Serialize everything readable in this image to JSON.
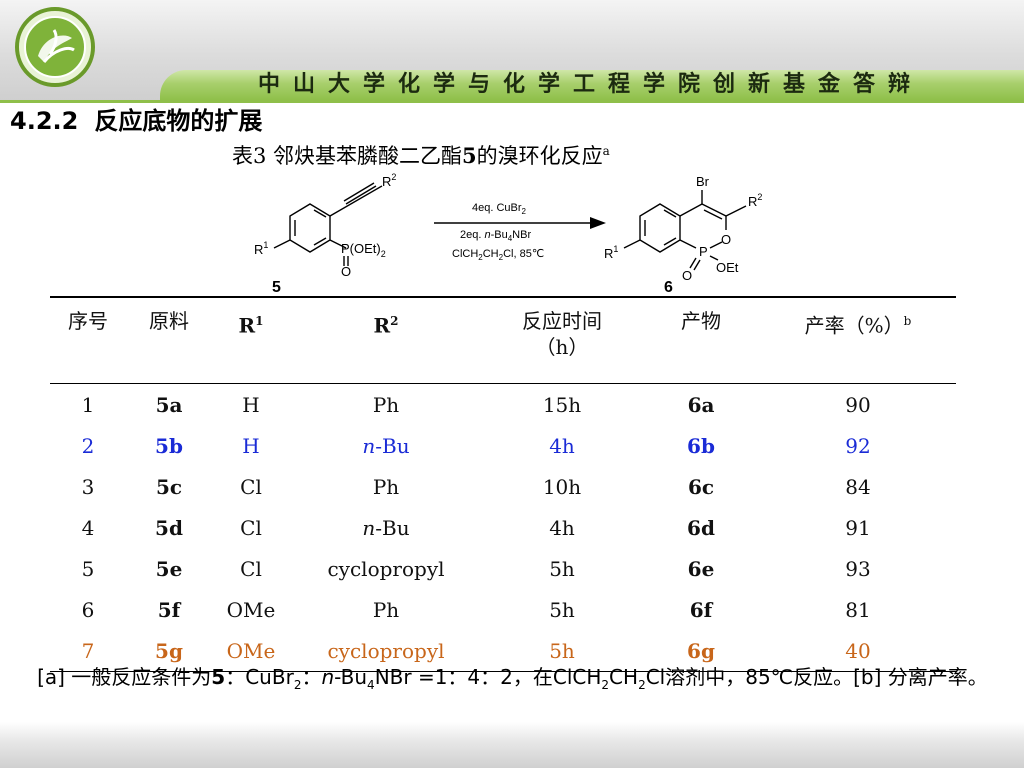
{
  "header": {
    "banner_text": "中山大学化学与化学工程学院创新基金答辩",
    "colors": {
      "strip": "#9fc95c",
      "line": "#8fbf4a",
      "logo": "#6a9a2a"
    }
  },
  "section": {
    "number": "4.2.2",
    "title": "反应底物的扩展"
  },
  "caption": {
    "prefix": "表3 邻炔基苯膦酸二乙酯",
    "bold_num": "5",
    "suffix": "的溴环化反应",
    "sup": "a"
  },
  "scheme": {
    "reactant_label": "5",
    "product_label": "6",
    "reactant": {
      "r1": "R",
      "r1_sup": "1",
      "r2": "R",
      "r2_sup": "2",
      "phos": "P(OEt)",
      "phos_sub": "2",
      "oxo": "O"
    },
    "product": {
      "br": "Br",
      "r1": "R",
      "r1_sup": "1",
      "r2": "R",
      "r2_sup": "2",
      "p": "P",
      "ring_o": "O",
      "oet": "OEt",
      "oxo": "O"
    },
    "conditions": {
      "line1_a": "4eq. CuBr",
      "line1_sub": "2",
      "line2_a": "2eq. ",
      "line2_it": "n",
      "line2_b": "-Bu",
      "line2_sub": "4",
      "line2_c": "NBr",
      "line3_a": "ClCH",
      "line3_sub1": "2",
      "line3_b": "CH",
      "line3_sub2": "2",
      "line3_c": "Cl, 85℃"
    }
  },
  "table": {
    "headers": {
      "no": "序号",
      "material": "原料",
      "r1": "R",
      "r1_sup": "1",
      "r2": "R",
      "r2_sup": "2",
      "time_l1": "反应时间",
      "time_l2": "（h）",
      "product": "产物",
      "yield": "产率（%）",
      "yield_sup": "b"
    },
    "rows": [
      {
        "no": "1",
        "material": "5a",
        "r1": "H",
        "r2_pre": "",
        "r2": "Ph",
        "time": "15h",
        "product": "6a",
        "yield": "90"
      },
      {
        "no": "2",
        "material": "5b",
        "r1": "H",
        "r2_pre": "n",
        "r2": "-Bu",
        "time": "4h",
        "product": "6b",
        "yield": "92"
      },
      {
        "no": "3",
        "material": "5c",
        "r1": "Cl",
        "r2_pre": "",
        "r2": "Ph",
        "time": "10h",
        "product": "6c",
        "yield": "84"
      },
      {
        "no": "4",
        "material": "5d",
        "r1": "Cl",
        "r2_pre": "n",
        "r2": "-Bu",
        "time": "4h",
        "product": "6d",
        "yield": "91"
      },
      {
        "no": "5",
        "material": "5e",
        "r1": "Cl",
        "r2_pre": "",
        "r2": "cyclopropyl",
        "time": "5h",
        "product": "6e",
        "yield": "93"
      },
      {
        "no": "6",
        "material": "5f",
        "r1": "OMe",
        "r2_pre": "",
        "r2": "Ph",
        "time": "5h",
        "product": "6f",
        "yield": "81"
      },
      {
        "no": "7",
        "material": "5g",
        "r1": "OMe",
        "r2_pre": "",
        "r2": "cyclopropyl",
        "time": "5h",
        "product": "6g",
        "yield": "40"
      }
    ],
    "row_colors": {
      "highlight_blue": "#1a2bd6",
      "highlight_orange": "#c8661a"
    }
  },
  "footnote": {
    "p1": "[a] 一般反应条件为",
    "b5": "5",
    "p2": "：CuBr",
    "s2": "2",
    "p3": "：",
    "it_n": "n",
    "p4": "-Bu",
    "s4": "4",
    "p5": "NBr =1：4：2，在ClCH",
    "s5a": "2",
    "p6": "CH",
    "s5b": "2",
    "p7": "Cl溶剂中，85℃反应。[b] 分离产率。"
  }
}
